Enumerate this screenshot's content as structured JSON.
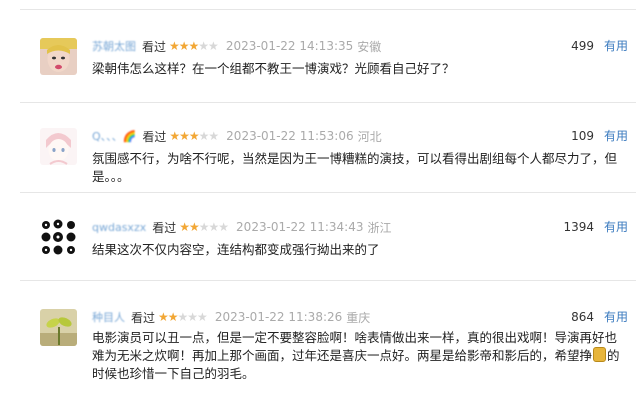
{
  "comments": [
    {
      "user": "苏朝太图",
      "watched": "看过",
      "stars": "★★★",
      "stars_off": "★★",
      "time": "2023-01-22 14:13:35",
      "location": "安徽",
      "votes": "499",
      "useful": "有用",
      "text": "梁朝伟怎么这样？在一个组都不教王一博演戏？光顾看自己好了？"
    },
    {
      "user": "Q、、、🌈",
      "watched": "看过",
      "stars": "★★★",
      "stars_off": "★★",
      "time": "2023-01-22 11:53:06",
      "location": "河北",
      "votes": "109",
      "useful": "有用",
      "text": "氛围感不行，为啥不行呢，当然是因为王一博糟糕的演技，可以看得出剧组每个人都尽力了，但是。。。"
    },
    {
      "user": "qwdasxzx",
      "watched": "看过",
      "stars": "★★",
      "stars_off": "★★★",
      "time": "2023-01-22 11:34:43",
      "location": "浙江",
      "votes": "1394",
      "useful": "有用",
      "text": "结果这次不仅内容空，连结构都变成强行拗出来的了"
    },
    {
      "user": "种目人",
      "watched": "看过",
      "stars": "★★",
      "stars_off": "★★★",
      "time": "2023-01-22 11:38:26",
      "location": "重庆",
      "votes": "864",
      "useful": "有用",
      "text_a": "电影演员可以丑一点，但是一定不要整容脸啊！啥表情做出来一样，真的很出戏啊！导演再好也难为无米之炊啊！再加上那个画面，过年还是喜庆一点好。两星是给影帝和影后的，希望挣",
      "text_b": "的时候也珍惜一下自己的羽毛。"
    }
  ],
  "icons": {
    "coin": "coin-icon"
  }
}
